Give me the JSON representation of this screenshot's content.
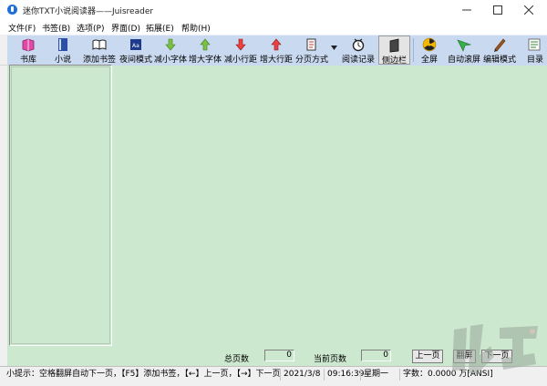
{
  "window": {
    "title": "迷你TXT小说阅读器——Juisreader",
    "min_glyph": "—",
    "max_glyph": "☐",
    "close_glyph": "✕"
  },
  "menu": [
    "文件(F)",
    "书签(B)",
    "选项(P)",
    "界面(D)",
    "拓展(E)",
    "帮助(H)"
  ],
  "toolbar": [
    {
      "label": "书库",
      "icon": "bookshelf-icon",
      "color": "#d23b9a"
    },
    {
      "label": "小说",
      "icon": "book-icon",
      "color": "#2c4fa6"
    },
    {
      "label": "添加书签",
      "icon": "open-book-icon",
      "color": "#333333"
    },
    {
      "label": "夜间模式",
      "icon": "night-mode-icon",
      "color": "#1e3a8a"
    },
    {
      "label": "减小字体",
      "icon": "arrow-down-green-icon",
      "color": "#6fb83a"
    },
    {
      "label": "增大字体",
      "icon": "arrow-up-green-icon",
      "color": "#6fb83a"
    },
    {
      "label": "减小行距",
      "icon": "arrow-down-red-icon",
      "color": "#e03030"
    },
    {
      "label": "增大行距",
      "icon": "arrow-up-red-icon",
      "color": "#e03030"
    },
    {
      "label": "分页方式",
      "icon": "page-mode-icon",
      "color": "#444444"
    },
    {
      "label": "阅读记录",
      "icon": "reading-record-icon",
      "color": "#222222"
    },
    {
      "label": "侧边栏",
      "icon": "sidebar-icon",
      "color": "#333333"
    },
    {
      "label": "全屏",
      "icon": "fullscreen-icon",
      "color": "#e8a800"
    },
    {
      "label": "自动滚屏",
      "icon": "auto-scroll-icon",
      "color": "#2aa83a"
    },
    {
      "label": "编辑模式",
      "icon": "edit-mode-icon",
      "color": "#8b4a12"
    },
    {
      "label": "目录",
      "icon": "catalog-icon",
      "color": "#3a7a3a"
    }
  ],
  "pager": {
    "total_label": "总页数",
    "total_value": "0",
    "current_label": "当前页数",
    "current_value": "0",
    "prev_label": "上一页",
    "flip_label": "翻屏",
    "next_label": "下一页"
  },
  "status": {
    "tip": "小提示：空格翻屏自动下一页，【F5】添加书签，【←】上一页，【→】下一页",
    "date": "2021/3/8",
    "time": "09:16:39",
    "weekday": "星期一",
    "charcount": "字数：0.0000 万[ANSI]"
  },
  "colors": {
    "reading_bg": "#cce8cf",
    "toolbar_bg": "#c9d9ef"
  }
}
